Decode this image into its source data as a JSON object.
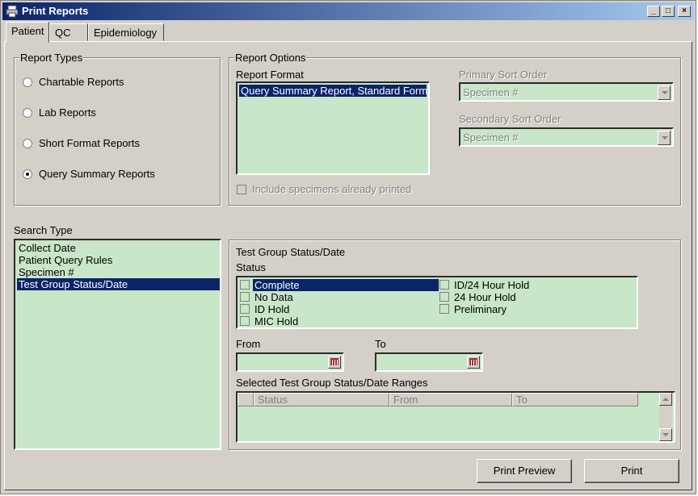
{
  "window": {
    "title": "Print Reports"
  },
  "tabs": [
    {
      "label": "Patient"
    },
    {
      "label": "QC"
    },
    {
      "label": "Epidemiology"
    }
  ],
  "report_types": {
    "legend": "Report Types",
    "options": [
      {
        "label": "Chartable Reports",
        "selected": false
      },
      {
        "label": "Lab Reports",
        "selected": false
      },
      {
        "label": "Short Format Reports",
        "selected": false
      },
      {
        "label": "Query Summary Reports",
        "selected": true
      }
    ]
  },
  "report_options": {
    "legend": "Report Options",
    "format_label": "Report Format",
    "formats": [
      "Query Summary Report, Standard Format"
    ],
    "primary_sort_label": "Primary Sort Order",
    "primary_sort_value": "Specimen #",
    "secondary_sort_label": "Secondary Sort Order",
    "secondary_sort_value": "Specimen #",
    "include_printed_label": "Include specimens already printed"
  },
  "search_type": {
    "label": "Search Type",
    "items": [
      "Collect Date",
      "Patient Query Rules",
      "Specimen #",
      "Test Group Status/Date"
    ],
    "selected_index": 3
  },
  "status_panel": {
    "title": "Test Group Status/Date",
    "status_label": "Status",
    "statuses_left": [
      "Complete",
      "No Data",
      "ID Hold",
      "MIC Hold"
    ],
    "statuses_right": [
      "ID/24 Hour Hold",
      "24 Hour Hold",
      "Preliminary"
    ],
    "from_label": "From",
    "to_label": "To",
    "ranges_label": "Selected Test Group Status/Date Ranges",
    "columns": [
      "Status",
      "From",
      "To"
    ]
  },
  "buttons": {
    "print_preview": "Print Preview",
    "print": "Print"
  },
  "colors": {
    "field_bg": "#c8e6c8",
    "selection": "#0a246a",
    "titlebar": "#0a246a"
  }
}
